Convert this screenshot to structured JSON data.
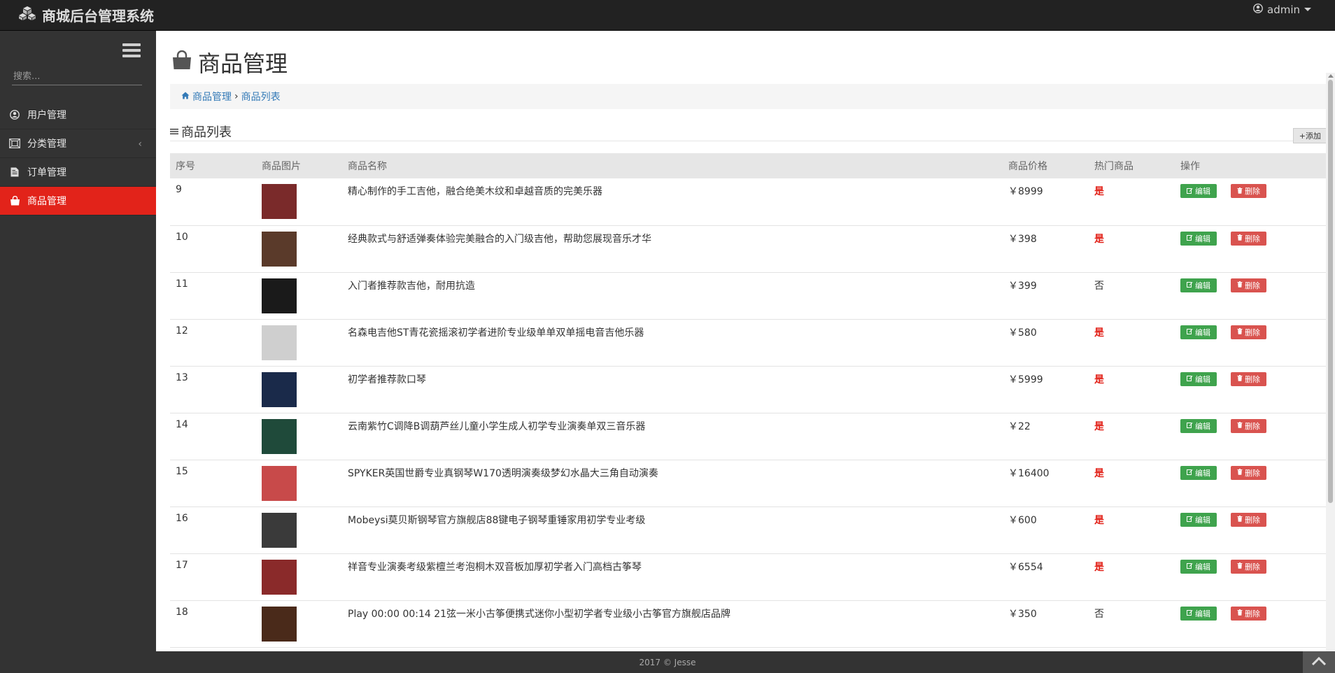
{
  "app": {
    "title": "商城后台管理系统",
    "user": "admin"
  },
  "sidebar": {
    "search_placeholder": "搜索...",
    "items": [
      {
        "label": "用户管理",
        "icon": "user-circle-icon"
      },
      {
        "label": "分类管理",
        "icon": "sitemap-icon"
      },
      {
        "label": "订单管理",
        "icon": "file-icon"
      },
      {
        "label": "商品管理",
        "icon": "shopping-bag-icon",
        "active": true
      }
    ]
  },
  "main": {
    "page_title": "商品管理",
    "breadcrumb": [
      "商品管理",
      "商品列表"
    ],
    "list_title": "商品列表",
    "add_label": "添加"
  },
  "table": {
    "headers": [
      "序号",
      "商品图片",
      "商品名称",
      "商品价格",
      "热门商品",
      "操作"
    ],
    "edit_label": "编辑",
    "delete_label": "删除",
    "rows": [
      {
        "no": "9",
        "name": "精心制作的手工吉他，融合绝美木纹和卓越音质的完美乐器",
        "price": "￥8999",
        "hot": "是",
        "img_color": "#7a2a2a"
      },
      {
        "no": "10",
        "name": "经典款式与舒适弹奏体验完美融合的入门级吉他，帮助您展现音乐才华",
        "price": "￥398",
        "hot": "是",
        "img_color": "#5a3a2a"
      },
      {
        "no": "11",
        "name": "入门者推荐款吉他，耐用抗造",
        "price": "￥399",
        "hot": "否",
        "img_color": "#1a1a1a"
      },
      {
        "no": "12",
        "name": "名森电吉他ST青花瓷摇滚初学者进阶专业级单单双单摇电音吉他乐器",
        "price": "￥580",
        "hot": "是",
        "img_color": "#cfcfcf"
      },
      {
        "no": "13",
        "name": "初学者推荐款口琴",
        "price": "￥5999",
        "hot": "是",
        "img_color": "#1a2a4a"
      },
      {
        "no": "14",
        "name": "云南紫竹C调降B调葫芦丝儿童小学生成人初学专业演奏单双三音乐器",
        "price": "￥22",
        "hot": "是",
        "img_color": "#1f4a3a"
      },
      {
        "no": "15",
        "name": "SPYKER英国世爵专业真钢琴W170透明演奏级梦幻水晶大三角自动演奏",
        "price": "￥16400",
        "hot": "是",
        "img_color": "#c84a4a"
      },
      {
        "no": "16",
        "name": "Mobeysi莫贝斯钢琴官方旗舰店88键电子钢琴重锤家用初学专业考级",
        "price": "￥600",
        "hot": "是",
        "img_color": "#3a3a3a"
      },
      {
        "no": "17",
        "name": "祥音专业演奏考级紫檀兰考泡桐木双音板加厚初学者入门高档古筝琴",
        "price": "￥6554",
        "hot": "是",
        "img_color": "#8a2a2a"
      },
      {
        "no": "18",
        "name": "Play 00:00 00:14 21弦一米小古筝便携式迷你小型初学者专业级小古筝官方旗舰店品牌",
        "price": "￥350",
        "hot": "否",
        "img_color": "#4a2a1a"
      }
    ]
  },
  "footer": {
    "text": "2017 © Jesse"
  }
}
